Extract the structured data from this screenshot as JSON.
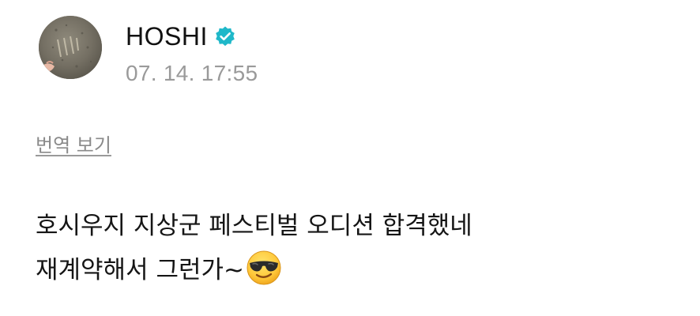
{
  "post": {
    "author": {
      "name": "HOSHI",
      "verified": true,
      "avatar_icon": "avatar-photo-icon"
    },
    "timestamp": "07. 14. 17:55",
    "translate_label": "번역 보기",
    "text_lines": [
      "호시우지 지상군 페스티벌 오디션 합격했네",
      "재계약해서 그런가~"
    ],
    "emoji": "smiling-face-with-sunglasses-icon"
  },
  "colors": {
    "verified_badge": "#1fb8c9",
    "timestamp": "#9a9a9a",
    "translate_link": "#8a8a8a",
    "text": "#151515"
  }
}
